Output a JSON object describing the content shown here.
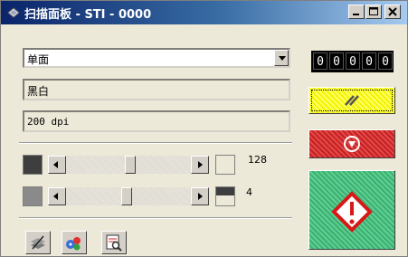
{
  "window": {
    "title": "扫描面板 - STI - 0000",
    "buttons": {
      "minimize_icon": "minimize-icon",
      "maximize_icon": "maximize-icon",
      "close_icon": "close-icon"
    }
  },
  "scan": {
    "mode": "单面",
    "color": "黑白",
    "resolution": "200 dpi"
  },
  "sliders": {
    "brightness": {
      "value": "128",
      "level": 0.5
    },
    "contrast": {
      "value": "4",
      "level": 0.45
    }
  },
  "counter": {
    "digits": [
      "0",
      "0",
      "0",
      "0",
      "0"
    ]
  },
  "actions": {
    "reset_icon": "double-slash-icon",
    "stop_icon": "stop-icon",
    "start_icon": "start-diamond-icon"
  },
  "toolbar": {
    "icons": [
      "layers-icon",
      "settings-icon",
      "preview-icon"
    ]
  },
  "colors": {
    "yellow": "#f4f400",
    "red": "#c82020",
    "green": "#3bb070",
    "title_start": "#0a246a"
  }
}
